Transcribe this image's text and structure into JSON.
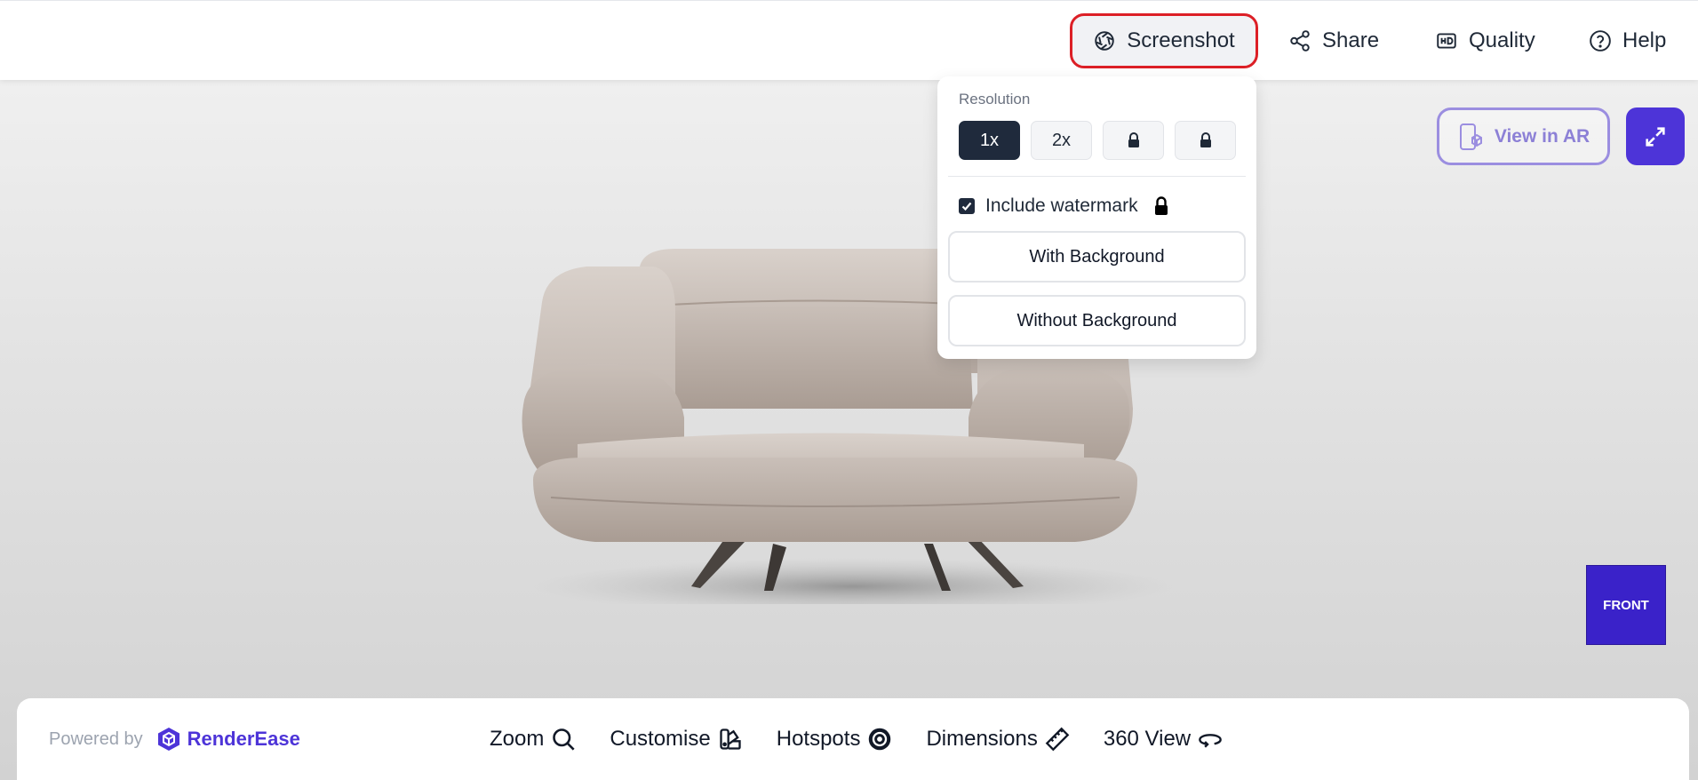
{
  "topbar": {
    "screenshot_label": "Screenshot",
    "share_label": "Share",
    "quality_label": "Quality",
    "help_label": "Help"
  },
  "screenshot_menu": {
    "resolution_label": "Resolution",
    "resolutions": [
      {
        "label": "1x",
        "selected": true,
        "locked": false
      },
      {
        "label": "2x",
        "selected": false,
        "locked": false
      },
      {
        "label": "",
        "selected": false,
        "locked": true
      },
      {
        "label": "",
        "selected": false,
        "locked": true
      }
    ],
    "watermark_label": "Include watermark",
    "watermark_checked": true,
    "with_background_label": "With Background",
    "without_background_label": "Without Background"
  },
  "viewer": {
    "ar_label": "View in AR",
    "cube_face_label": "FRONT"
  },
  "bottombar": {
    "powered_by": "Powered by",
    "brand_name": "RenderEase",
    "tools": {
      "zoom": "Zoom",
      "customise": "Customise",
      "hotspots": "Hotspots",
      "dimensions": "Dimensions",
      "view360": "360 View"
    }
  },
  "colors": {
    "accent": "#4d34d8",
    "highlight_outline": "#dc1f26",
    "selected_resolution": "#1f2a3c",
    "cube": "#3a22c9"
  },
  "icons": {
    "screenshot": "aperture-icon",
    "share": "share-icon",
    "quality": "hd-icon",
    "help": "help-circle-icon",
    "lock": "lock-icon",
    "ar": "ar-phone-icon",
    "fullscreen": "expand-icon",
    "zoom": "search-icon",
    "customise": "swatch-icon",
    "hotspots": "target-icon",
    "dimensions": "ruler-icon",
    "view360": "rotate-360-icon"
  }
}
